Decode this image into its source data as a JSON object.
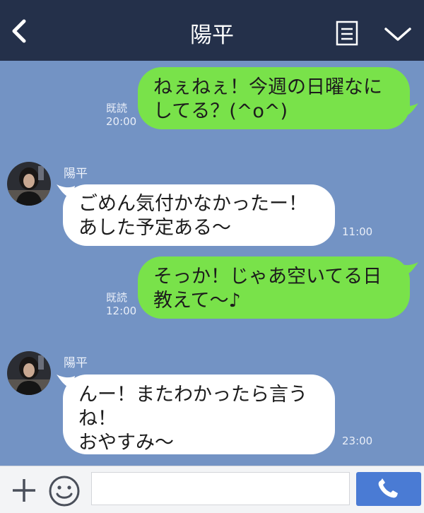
{
  "header": {
    "title": "陽平",
    "icons": {
      "back": "back-arrow-icon",
      "notes": "notes-icon",
      "more": "chevron-down-icon"
    }
  },
  "messages": [
    {
      "direction": "outgoing",
      "text": "ねぇねぇ！今週の日曜なにしてる？(^o^)",
      "read": "既読",
      "time": "20:00"
    },
    {
      "direction": "incoming",
      "sender": "陽平",
      "text": "ごめん気付かなかったー！\nあした予定ある〜",
      "time": "11:00"
    },
    {
      "direction": "outgoing",
      "text": "そっか！じゃあ空いてる日教えて〜♪",
      "read": "既読",
      "time": "12:00"
    },
    {
      "direction": "incoming",
      "sender": "陽平",
      "text": "んー！またわかったら言うね！\nおやすみ〜",
      "time": "23:00"
    }
  ],
  "footer": {
    "input_value": "",
    "icons": {
      "plus": "plus-icon",
      "emoji": "smile-icon",
      "call": "phone-icon"
    }
  },
  "colors": {
    "header_bg": "#24304a",
    "chat_bg": "#7393c4",
    "outgoing_bubble": "#79e24a",
    "incoming_bubble": "#ffffff",
    "call_button": "#4a7bd4"
  }
}
